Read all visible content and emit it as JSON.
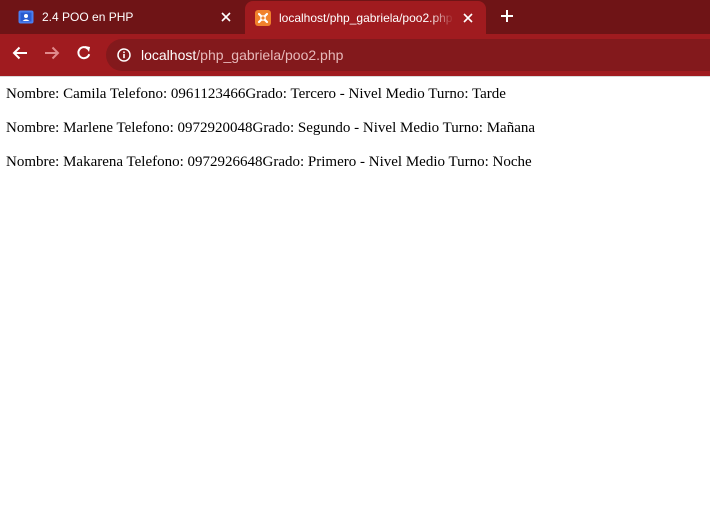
{
  "browser": {
    "tabs": [
      {
        "title": "2.4 POO en PHP",
        "favicon": "google-classroom-icon",
        "active": false
      },
      {
        "title": "localhost/php_gabriela/poo2.php",
        "favicon": "xampp-icon",
        "active": true
      }
    ],
    "address_bar": {
      "host": "localhost",
      "path": "/php_gabriela/poo2.php"
    },
    "colors": {
      "tabstrip": "#6f1416",
      "active_tab": "#a01b1f",
      "omnibox": "#83191c"
    }
  },
  "page": {
    "lines": [
      "Nombre: Camila Telefono: 0961123466Grado: Tercero - Nivel Medio Turno: Tarde",
      "Nombre: Marlene Telefono: 0972920048Grado: Segundo - Nivel Medio Turno: Mañana",
      "Nombre: Makarena Telefono: 0972926648Grado: Primero - Nivel Medio Turno: Noche"
    ]
  }
}
